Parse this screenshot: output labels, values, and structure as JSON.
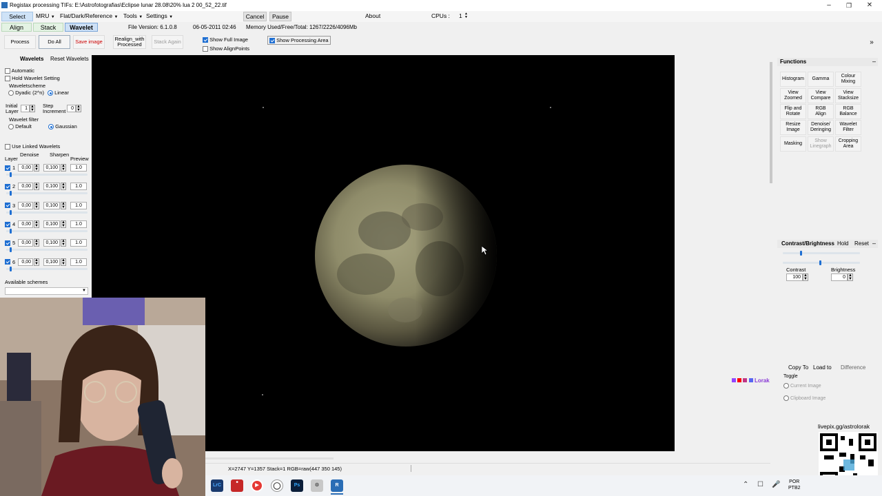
{
  "window": {
    "title": "Registax processing TIFs: E:\\Astrofotografias\\Eclipse lunar 28.08\\20% lua 2 00_52_22.tif"
  },
  "menu": {
    "select": "Select",
    "mru": "MRU",
    "flat": "Flat/Dark/Reference",
    "tools": "Tools",
    "settings": "Settings",
    "cancel": "Cancel",
    "pause": "Pause",
    "about": "About",
    "cpus_label": "CPUs :",
    "cpus_value": "1"
  },
  "tabs": [
    "Align",
    "Stack",
    "Wavelet"
  ],
  "info": {
    "file_version": "File Version: 6.1.0.8",
    "date": "06-05-2011 02:46",
    "memory": "Memory Used/Free/Total: 1267/2226/4096Mb"
  },
  "toolbar": {
    "process": "Process",
    "do_all": "Do All",
    "save_image": "Save image",
    "realign_line1": "Realign_with",
    "realign_line2": "Processed",
    "stack_again": "Stack Again",
    "show_full_image": "Show Full Image",
    "show_align_points": "Show AlignPoints",
    "show_processing_area": "Show Processing Area"
  },
  "wavelet_panel": {
    "tab_wavelets": "Wavelets",
    "tab_reset": "Reset Wavelets",
    "automatic": "Automatic",
    "hold_wavelet_setting": "Hold Wavelet Setting",
    "waveletscheme": "Waveletscheme",
    "dyadic": "Dyadic (2^n)",
    "linear": "Linear",
    "initial_layer_1": "Initial",
    "initial_layer_2": "Layer",
    "initial_value": "1",
    "step_1": "Step",
    "step_2": "Increment",
    "step_value": "0",
    "wavelet_filter": "Wavelet filter",
    "default": "Default",
    "gaussian": "Gaussian",
    "use_linked": "Use Linked Wavelets",
    "col_denoise": "Denoise",
    "col_sharpen": "Sharpen",
    "col_layer": "Layer",
    "col_preview": "Preview",
    "layers": [
      {
        "num": "1",
        "denoise": "0,00",
        "sharpen": "0,100",
        "preview": "1.0"
      },
      {
        "num": "2",
        "denoise": "0,00",
        "sharpen": "0,100",
        "preview": "1.0"
      },
      {
        "num": "3",
        "denoise": "0,00",
        "sharpen": "0,100",
        "preview": "1.0"
      },
      {
        "num": "4",
        "denoise": "0,00",
        "sharpen": "0,100",
        "preview": "1.0"
      },
      {
        "num": "5",
        "denoise": "0,00",
        "sharpen": "0,100",
        "preview": "1.0"
      },
      {
        "num": "6",
        "denoise": "0,00",
        "sharpen": "0,100",
        "preview": "1.0"
      }
    ],
    "available_schemes": "Available schemes"
  },
  "functions": {
    "title": "Functions",
    "buttons": [
      [
        "Histogram",
        ""
      ],
      [
        "Gamma",
        ""
      ],
      [
        "Colour",
        "Mixing"
      ],
      [
        "View",
        "Zoomed"
      ],
      [
        "View",
        "Compare"
      ],
      [
        "View",
        "Stacksize"
      ],
      [
        "Flip and",
        "Rotate"
      ],
      [
        "RGB",
        "Align"
      ],
      [
        "RGB",
        "Balance"
      ],
      [
        "Resize",
        "Image"
      ],
      [
        "Denoise/",
        "Deringing"
      ],
      [
        "Wavelet",
        "Filter"
      ],
      [
        "Masking",
        ""
      ],
      [
        "Show",
        "Linegraph"
      ],
      [
        "Cropping",
        "Area"
      ]
    ]
  },
  "contrast": {
    "title": "Contrast/Brightness",
    "hold": "Hold",
    "reset": "Reset",
    "contrast_label": "Contrast",
    "contrast_value": "100",
    "brightness_label": "Brightness",
    "brightness_value": "0"
  },
  "copy_panel": {
    "copy_to": "Copy To",
    "load_to": "Load to",
    "difference": "Difference",
    "toggle": "Toggle",
    "current_image": "Current Image",
    "clipboard_image": "Clipboard Image"
  },
  "statusbar": {
    "text": "X=2747 Y=1357 Stack=1 RGB=raw(447 350 145)"
  },
  "overlay": {
    "livepix": "livepix.gg/astrolorak",
    "lorak": "Lorak"
  },
  "taskbar": {
    "lang_1": "POR",
    "lang_2": "PTB2"
  }
}
